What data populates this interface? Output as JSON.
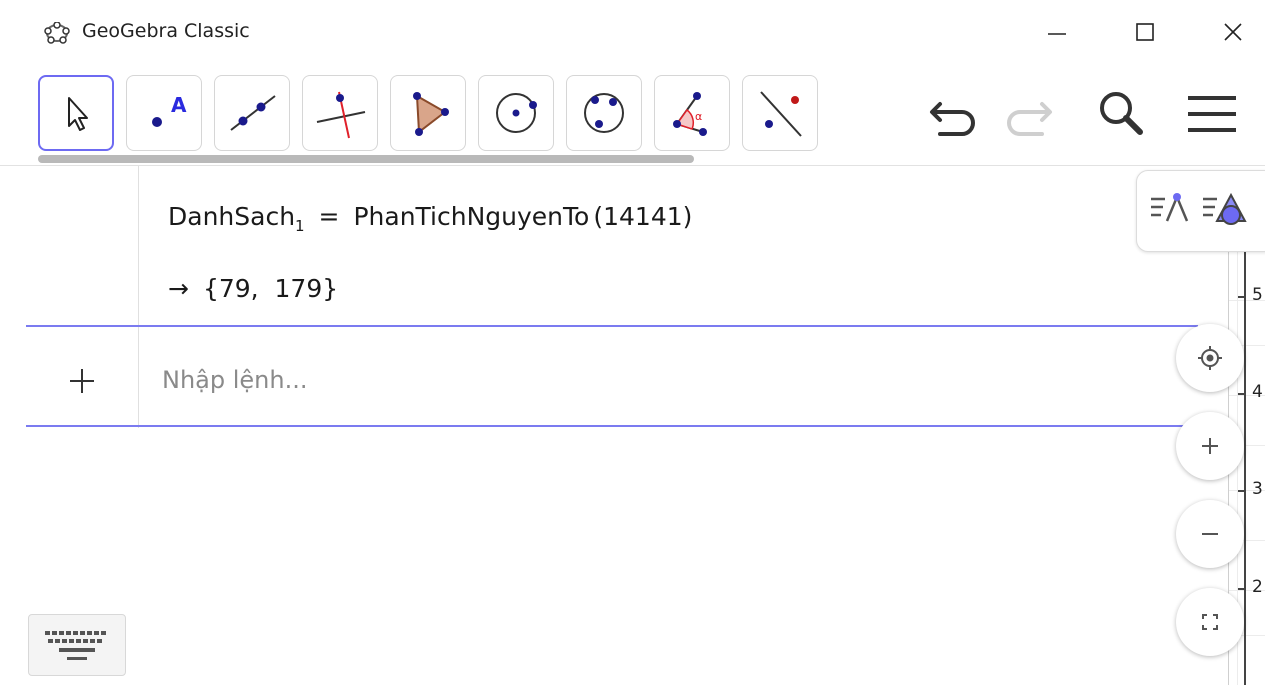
{
  "window": {
    "title": "GeoGebra Classic",
    "icon": "geogebra-logo-icon",
    "controls": [
      "minimize-icon",
      "maximize-icon",
      "close-icon"
    ]
  },
  "toolbar": {
    "tools": [
      {
        "icon": "move-pointer-icon",
        "active": true
      },
      {
        "icon": "point-icon",
        "label": "A"
      },
      {
        "icon": "line-through-two-points-icon"
      },
      {
        "icon": "perpendicular-line-icon"
      },
      {
        "icon": "polygon-icon"
      },
      {
        "icon": "circle-center-point-icon"
      },
      {
        "icon": "circle-through-three-points-icon"
      },
      {
        "icon": "angle-icon",
        "label": "α"
      },
      {
        "icon": "reflect-about-line-icon"
      }
    ],
    "actions": [
      "undo-icon",
      "redo-icon",
      "search-icon",
      "menu-icon"
    ]
  },
  "algebra": {
    "command": {
      "name": "DanhSach",
      "subscript": "1",
      "equals": "=",
      "function": "PhanTichNguyenTo",
      "argument": "(14141)"
    },
    "result": {
      "arrow": "→",
      "value": "{79,  179}"
    },
    "input": {
      "add_label": "+",
      "placeholder": "Nhập lệnh..."
    }
  },
  "graphics": {
    "y_ticks": [
      "5",
      "4",
      "3",
      "2"
    ]
  },
  "colors": {
    "accent": "#6d6af2",
    "divider": "#7b7bf0",
    "point": "#1a1a8c",
    "polygon_fill": "#d9a58a",
    "angle_red": "#e0202a"
  }
}
